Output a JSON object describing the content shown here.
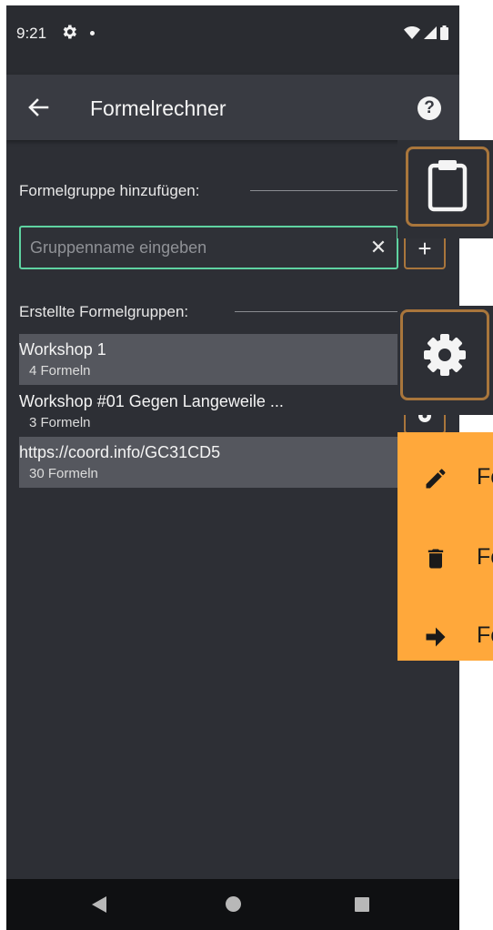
{
  "status_bar": {
    "time": "9:21"
  },
  "app_bar": {
    "title": "Formelrechner"
  },
  "add_section": {
    "label": "Formelgruppe hinzufügen:",
    "placeholder": "Gruppenname eingeben",
    "value": ""
  },
  "groups_section": {
    "label": "Erstellte Formelgruppen:",
    "items": [
      {
        "name": "Workshop 1",
        "count": "4 Formeln"
      },
      {
        "name": "Workshop #01 Gegen Langeweile ...",
        "count": "3 Formeln"
      },
      {
        "name": "https://coord.info/GC31CD5",
        "count": "30 Formeln"
      }
    ]
  },
  "context_menu": {
    "items": [
      {
        "label": "Fo",
        "icon": "pencil-icon"
      },
      {
        "label": "Fo",
        "icon": "trash-icon"
      },
      {
        "label": "Fo",
        "icon": "arrow-right-icon"
      }
    ]
  },
  "colors": {
    "background": "#2d2f35",
    "app_bar": "#393b42",
    "accent_input": "#5fd3a1",
    "highlight_border": "#a9763c",
    "menu": "#ffa83b"
  }
}
